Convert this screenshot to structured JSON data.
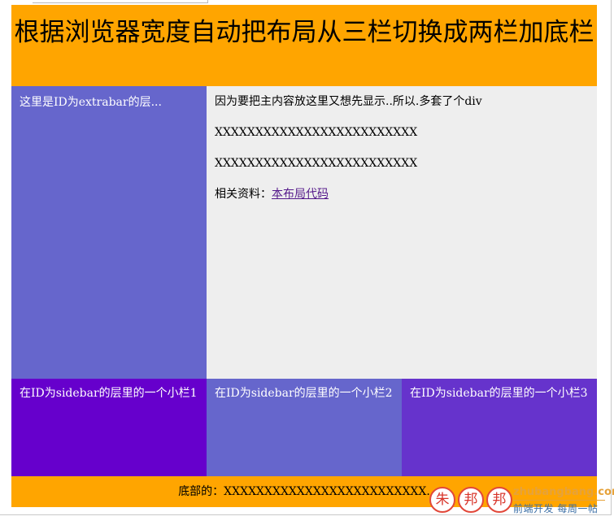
{
  "header": {
    "title": "根据浏览器宽度自动把布局从三栏切换成两栏加底栏"
  },
  "extrabar": {
    "text": "这里是ID为extrabar的层..."
  },
  "main": {
    "intro": "因为要把主内容放这里又想先显示..所以.多套了个div",
    "line1": "XXXXXXXXXXXXXXXXXXXXXXXXX",
    "line2": "XXXXXXXXXXXXXXXXXXXXXXXXX",
    "related_label": "相关资料：",
    "related_link": "本布局代码"
  },
  "sidebar": {
    "boxes": [
      {
        "text": "在ID为sidebar的层里的一个小栏1"
      },
      {
        "text": "在ID为sidebar的层里的一个小栏2"
      },
      {
        "text": "在ID为sidebar的层里的一个小栏3"
      }
    ]
  },
  "footer": {
    "text": "底部的：XXXXXXXXXXXXXXXXXXXXXXXXX."
  },
  "watermark": {
    "seal_chars": [
      "朱",
      "邦",
      "邦"
    ],
    "domain": "zhubangbang.com",
    "slogan": "前端开发 每周一帖"
  },
  "colors": {
    "header_footer": "#ffa500",
    "extrabar": "#6666cc",
    "main": "#eeeeee",
    "box1": "#6600cc",
    "box2": "#6666cc",
    "box3": "#6633cc",
    "link_visited": "#551a8b"
  }
}
